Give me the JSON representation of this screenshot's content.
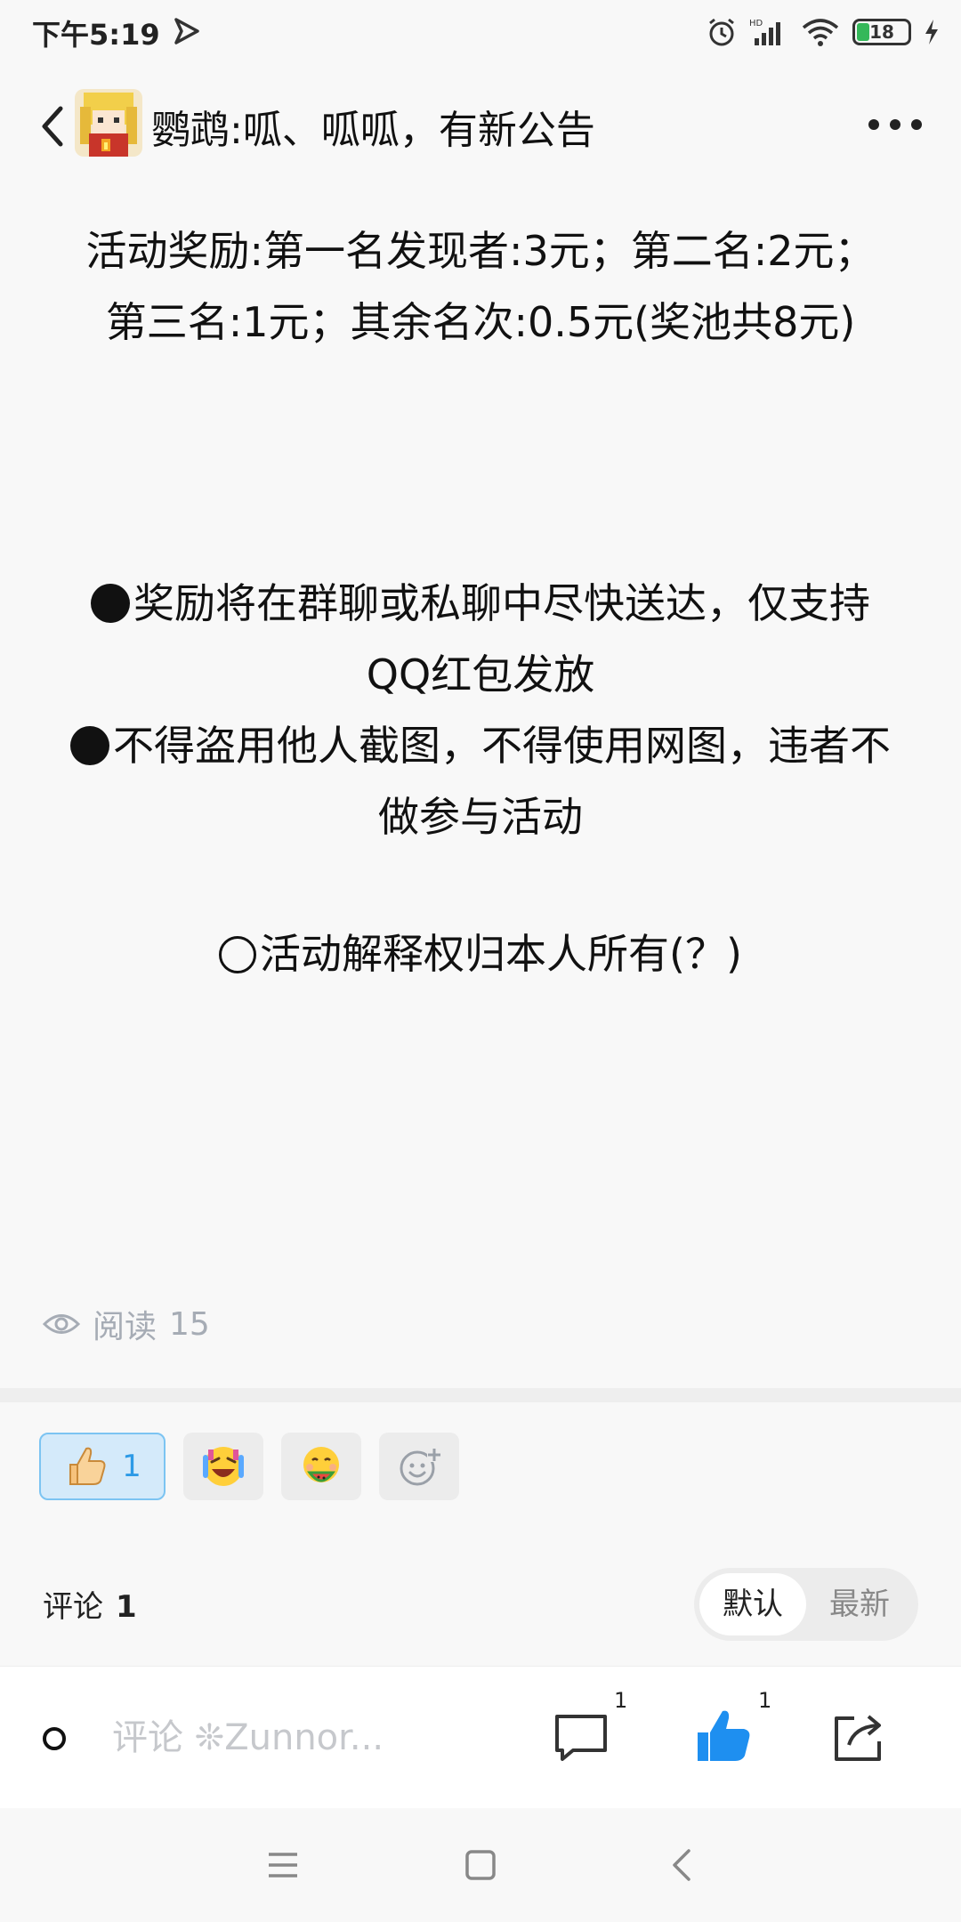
{
  "status_bar": {
    "time": "下午5:19",
    "battery": "18",
    "icons": [
      "play-icon",
      "alarm-icon",
      "hd-signal-icon",
      "wifi-icon",
      "battery-icon",
      "charging-icon"
    ]
  },
  "header": {
    "title": "鹦鹉:呱、呱呱，有新公告",
    "icons": [
      "back-icon",
      "avatar",
      "more-icon"
    ]
  },
  "post": {
    "reward_line1": "活动奖励:第一名发现者:3元；第二名:2元；",
    "reward_line2": "第三名:1元；其余名次:0.5元(奖池共8元)",
    "rule1_line1": "奖励将在群聊或私聊中尽快送达，仅支持",
    "rule1_line2": "QQ红包发放",
    "rule2_line1": "不得盗用他人截图，不得使用网图，违者不",
    "rule2_line2": "做参与活动",
    "note": "活动解释权归本人所有(？)"
  },
  "reads": {
    "label": "阅读",
    "count": "15"
  },
  "reactions": {
    "like_count": "1",
    "items": [
      "thumbs-up-emoji",
      "laughing-tears-emoji",
      "watermelon-emoji",
      "add-reaction-icon"
    ]
  },
  "comments": {
    "label": "评论",
    "count": "1",
    "sort_default": "默认",
    "sort_latest": "最新"
  },
  "bottom_bar": {
    "placeholder": "评论 ❊Zunnor...",
    "comment_badge": "1",
    "like_badge": "1",
    "colors": {
      "like": "#1e8ff0"
    }
  },
  "nav": [
    "menu-icon",
    "home-icon",
    "back-nav-icon"
  ]
}
